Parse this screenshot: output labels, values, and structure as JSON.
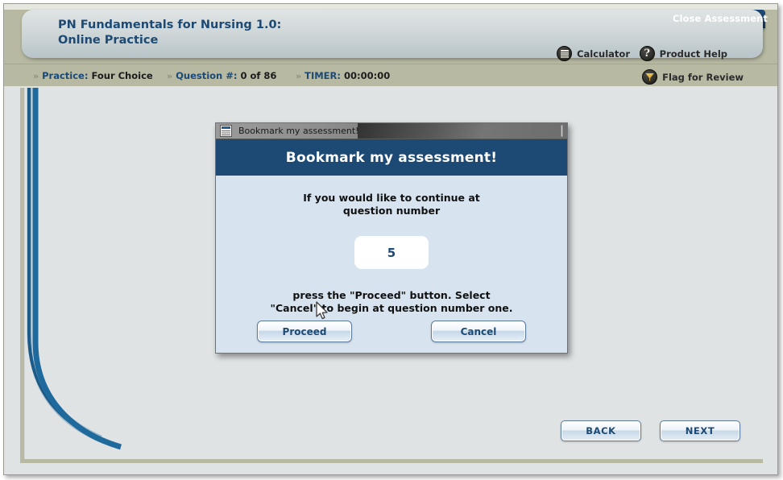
{
  "header": {
    "title": "PN Fundamentals for Nursing 1.0:\nOnline Practice",
    "close_assessment": "Close Assessment",
    "tools": [
      {
        "label": "Calculator",
        "icon": "calculator-icon"
      },
      {
        "label": "Product Help",
        "icon": "question-mark-icon"
      }
    ]
  },
  "statusbar": {
    "chevron": "»",
    "items": [
      {
        "label": "Practice:",
        "value": "Four Choice"
      },
      {
        "label": "Question #:",
        "value": "0 of 86"
      },
      {
        "label": "TIMER:",
        "value": "00:00:00"
      }
    ],
    "flag_for_review": "Flag for Review",
    "flag_icon": "flag-icon"
  },
  "navigation": {
    "back_label": "BACK",
    "next_label": "NEXT"
  },
  "dialog": {
    "window_title": "Bookmark my assessment!",
    "window_icon": "document-icon",
    "heading": "Bookmark my assessment!",
    "paragraph_top": "If you would like to continue at\nquestion number",
    "question_number": "5",
    "paragraph_bottom": "press the \"Proceed\" button. Select\n\"Cancel\" to begin at question number one.",
    "proceed_label": "Proceed",
    "cancel_label": "Cancel"
  },
  "colors": {
    "navy": "#1c4a74",
    "khaki": "#b7b9a2",
    "content_bg": "#dfe3e3",
    "dialog_bg": "#d7e4ef"
  }
}
